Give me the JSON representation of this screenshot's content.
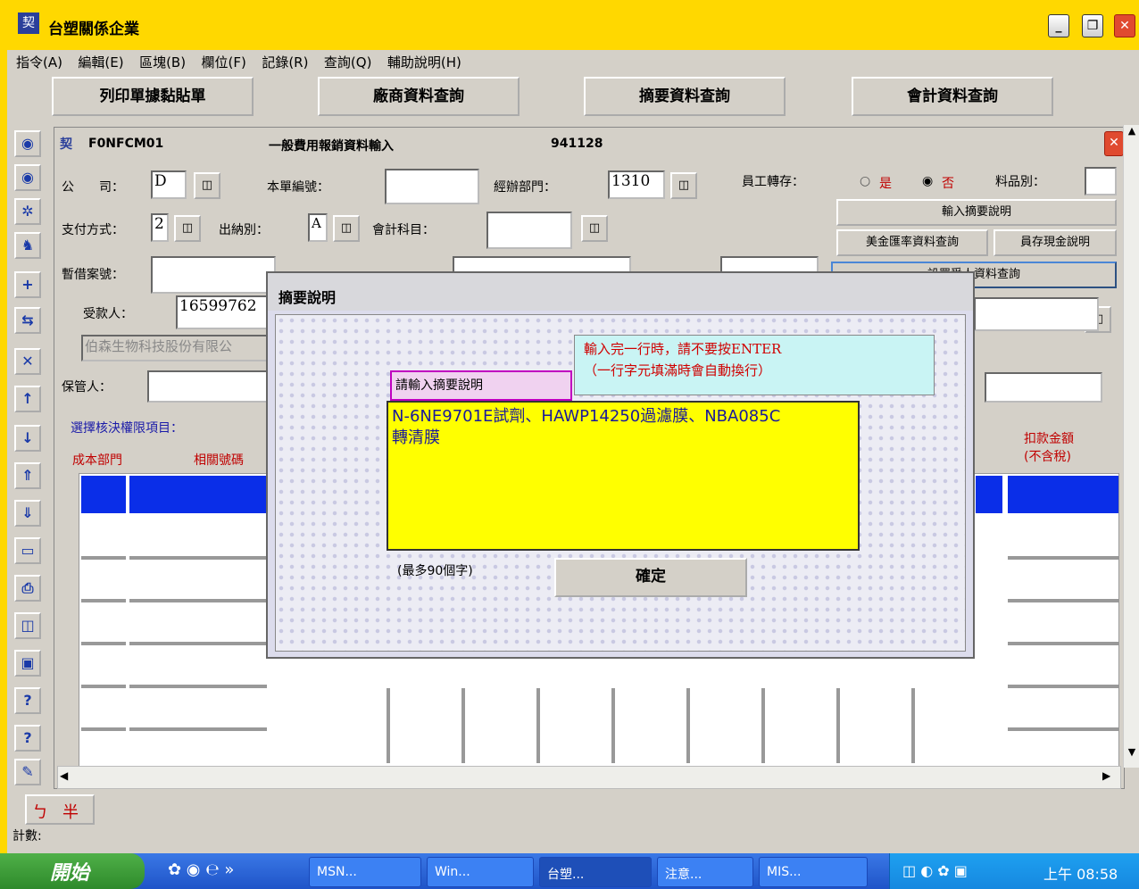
{
  "window": {
    "title": "台塑關係企業"
  },
  "menu": [
    "指令(A)",
    "編輯(E)",
    "區塊(B)",
    "欄位(F)",
    "記錄(R)",
    "查詢(Q)",
    "輔助說明(H)"
  ],
  "top_buttons": [
    "列印單據黏貼單",
    "廠商資料查詢",
    "摘要資料查詢",
    "會計資料查詢"
  ],
  "form": {
    "code": "F0NFCM01",
    "name": "一般費用報銷資料輸入",
    "date": "941128",
    "company_label": "公　　司：",
    "company_value": "D",
    "doc_no_label": "本單編號：",
    "doc_no_value": "",
    "dept_label": "經辦部門：",
    "dept_value": "1310",
    "emp_label": "員工轉存：",
    "emp_yes": "是",
    "emp_no": "否",
    "item_label": "料品別：",
    "pay_label": "支付方式：",
    "pay_value": "2",
    "cashier_label": "出納別：",
    "cashier_value": "A",
    "account_label": "會計科目：",
    "advance_label": "暫借案號：",
    "payee_label": "受款人：",
    "payee_value": "16599762",
    "payee_name": "伯森生物科技股份有限公",
    "keeper_label": "保管人：",
    "approve_label": "選擇核決權限項目：",
    "btn_summary": "輸入摘要說明",
    "btn_foreign": "美金匯率資料查詢",
    "btn_petty": "員存現金說明",
    "btn_receiver": "設買受人資料查詢",
    "col_cost": "成本部門",
    "col_ref": "相關號碼",
    "col_deduct": "扣款金額",
    "col_deduct2": "(不含稅)"
  },
  "dialog": {
    "title": "摘要說明",
    "note_line1": "輸入完一行時，請不要按ENTER",
    "note_line2": "（一行字元填滿時會自動換行）",
    "prompt": "請輸入摘要說明",
    "text_line1": "N-6NE9701E試劑、HAWP14250過濾膜、NBA085C",
    "text_line2": "轉清膜",
    "limit": "(最多90個字)",
    "ok": "確定"
  },
  "status": {
    "ime1": "ㄅ",
    "ime2": "半",
    "count": "計數:"
  },
  "taskbar": {
    "start": "開始",
    "tasks": [
      "MSN...",
      "Win...",
      "台塑...",
      "注意...",
      "MIS..."
    ],
    "clock": "上午 08:58"
  }
}
